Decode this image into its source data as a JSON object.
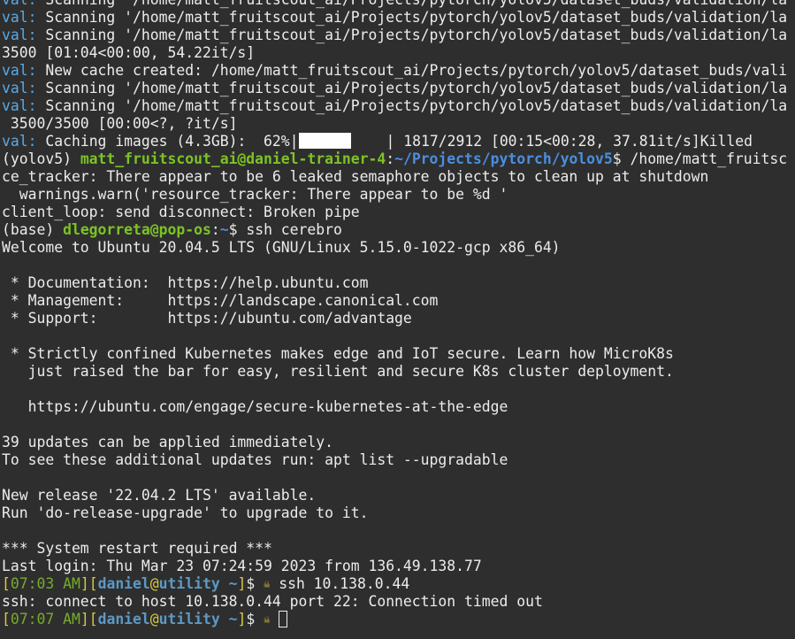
{
  "terminal": {
    "lines": {
      "l0": {
        "prefix": "val:",
        "text": " Scanning '/home/matt_fruitscout_ai/Projects/pytorch/yolov5/dataset_buds/validation/la"
      },
      "l1": {
        "prefix": "val:",
        "text": " Scanning '/home/matt_fruitscout_ai/Projects/pytorch/yolov5/dataset_buds/validation/la"
      },
      "l2": {
        "prefix": "val:",
        "text": " Scanning '/home/matt_fruitscout_ai/Projects/pytorch/yolov5/dataset_buds/validation/la"
      },
      "l3": {
        "text": "3500 [01:04<00:00, 54.22it/s]"
      },
      "l4": {
        "prefix": "val:",
        "text": " New cache created: /home/matt_fruitscout_ai/Projects/pytorch/yolov5/dataset_buds/vali"
      },
      "l5": {
        "prefix": "val:",
        "text": " Scanning '/home/matt_fruitscout_ai/Projects/pytorch/yolov5/dataset_buds/validation/la"
      },
      "l6": {
        "prefix": "val:",
        "text": " Scanning '/home/matt_fruitscout_ai/Projects/pytorch/yolov5/dataset_buds/validation/la"
      },
      "l7": {
        "text": " 3500/3500 [00:00<?, ?it/s]"
      },
      "l8": {
        "prefix": "val:",
        "text_before": " Caching images (4.3GB):  62%|",
        "text_after": "| 1817/2912 [00:15<00:28, 37.81it/s]Killed"
      },
      "l9": {
        "env": "(yolov5) ",
        "userhost": "matt_fruitscout_ai@daniel-trainer-4",
        "colon": ":",
        "path": "~/Projects/pytorch/yolov5",
        "cmd": "$ /home/matt_fruitsc"
      },
      "l10": {
        "text": "ce_tracker: There appear to be 6 leaked semaphore objects to clean up at shutdown"
      },
      "l11": {
        "text": "  warnings.warn('resource_tracker: There appear to be %d '"
      },
      "l12": {
        "text": "client_loop: send disconnect: Broken pipe"
      },
      "l13": {
        "env": "(base) ",
        "userhost": "dlegorreta@pop-os",
        "colon": ":",
        "path": "~",
        "cmd": "$ ssh cerebro"
      },
      "l14": {
        "text": "Welcome to Ubuntu 20.04.5 LTS (GNU/Linux 5.15.0-1022-gcp x86_64)"
      },
      "l16": {
        "text": " * Documentation:  https://help.ubuntu.com"
      },
      "l17": {
        "text": " * Management:     https://landscape.canonical.com"
      },
      "l18": {
        "text": " * Support:        https://ubuntu.com/advantage"
      },
      "l20": {
        "text": " * Strictly confined Kubernetes makes edge and IoT secure. Learn how MicroK8s"
      },
      "l21": {
        "text": "   just raised the bar for easy, resilient and secure K8s cluster deployment."
      },
      "l23": {
        "text": "   https://ubuntu.com/engage/secure-kubernetes-at-the-edge"
      },
      "l25": {
        "text": "39 updates can be applied immediately."
      },
      "l26": {
        "text": "To see these additional updates run: apt list --upgradable"
      },
      "l28": {
        "text": "New release '22.04.2 LTS' available."
      },
      "l29": {
        "text": "Run 'do-release-upgrade' to upgrade to it."
      },
      "l31": {
        "text": "*** System restart required ***"
      },
      "l32": {
        "text": "Last login: Thu Mar 23 07:24:59 2023 from 136.49.138.77"
      },
      "l33": {
        "open1": "[",
        "time": "07:03 AM",
        "close1": "]",
        "open2": "[",
        "user": "daniel",
        "at": "@",
        "host": "utility ~",
        "close2": "]",
        "dollar": "$ ",
        "cmd": " ssh 10.138.0.44"
      },
      "l34": {
        "text": "ssh: connect to host 10.138.0.44 port 22: Connection timed out"
      },
      "l35": {
        "open1": "[",
        "time": "07:07 AM",
        "close1": "]",
        "open2": "[",
        "user": "daniel",
        "at": "@",
        "host": "utility ~",
        "close2": "]",
        "dollar": "$ ",
        "cmd": " "
      }
    },
    "progress": {
      "percent": 62
    },
    "icons": {
      "prompt_icon": "skull-icon",
      "prompt_icon_glyph": "☠"
    },
    "colors": {
      "background": "#2e2e2e",
      "text": "#ececec",
      "val_prefix": "#5aa9e6",
      "user_host_green": "#7cc324",
      "path_blue": "#4a8fe0",
      "prompt_time_green": "#78ab2c",
      "prompt_user_blue": "#5c99c4",
      "prompt_bracket_yellow": "#d8c93c"
    }
  }
}
